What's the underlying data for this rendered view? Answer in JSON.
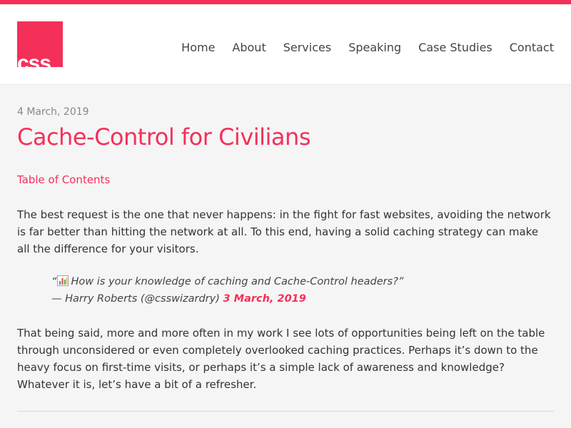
{
  "logo": {
    "text": "css",
    "color": "#f43059"
  },
  "nav": {
    "items": [
      {
        "label": "Home"
      },
      {
        "label": "About"
      },
      {
        "label": "Services"
      },
      {
        "label": "Speaking"
      },
      {
        "label": "Case Studies"
      },
      {
        "label": "Contact"
      }
    ]
  },
  "post": {
    "date": "4 March, 2019",
    "title": "Cache-Control for Civilians",
    "toc_label": "Table of Contents",
    "paragraph1": "The best request is the one that never happens: in the fight for fast websites, avoiding the network is far better than hitting the network at all. To this end, having a solid caching strategy can make all the difference for your visitors.",
    "quote": {
      "open_mark": "“",
      "icon": "bar-chart-icon",
      "text": "How is your knowledge of caching and Cache-Control headers?",
      "close_mark": "”",
      "attribution": "— Harry Roberts (@csswizardry)",
      "date_link": "3 March, 2019"
    },
    "paragraph2": "That being said, more and more often in my work I see lots of opportunities being left on the table through unconsidered or even completely overlooked caching practices. Perhaps it’s down to the heavy focus on first-time visits, or perhaps it’s a simple lack of awareness and knowledge? Whatever it is, let’s have a bit of a refresher."
  },
  "colors": {
    "accent": "#f43059",
    "background": "#f5f5f5",
    "text": "#333333"
  }
}
